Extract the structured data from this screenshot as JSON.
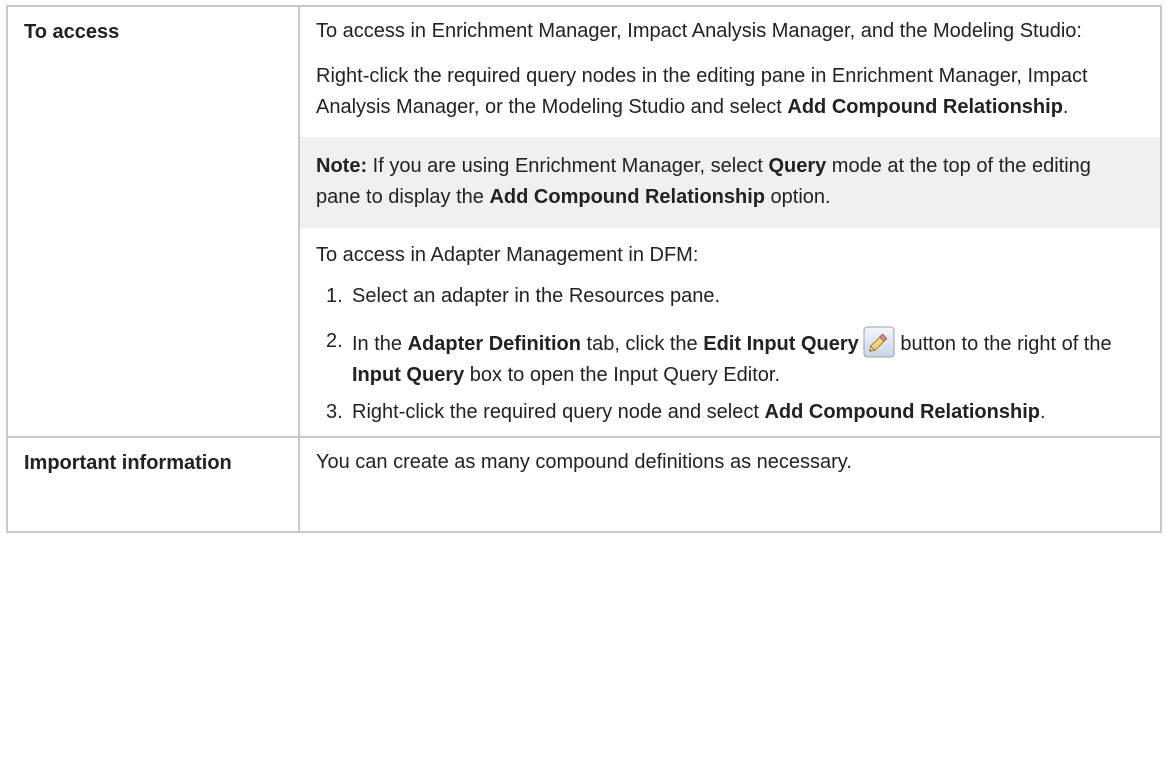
{
  "rows": {
    "access": {
      "label": "To access",
      "intro": "To access in Enrichment Manager, Impact Analysis Manager, and the Modeling Studio:",
      "right_click_pre": "Right-click the required query nodes in the editing pane in Enrichment Manager, Impact Analysis Manager, or the Modeling Studio and select ",
      "right_click_bold": "Add Compound Relationship",
      "right_click_post": ".",
      "note": {
        "label": "Note:",
        "text_1": " If you are using Enrichment Manager, select ",
        "bold_1": "Query",
        "text_2": " mode at the top of the editing pane to display the ",
        "bold_2": "Add Compound Relationship",
        "text_3": " option."
      },
      "adapter_intro": "To access in Adapter Management in DFM:",
      "steps": [
        {
          "num": "1.",
          "text": "Select an adapter in the Resources pane."
        },
        {
          "num": "2.",
          "text_1": "In the ",
          "bold_1": "Adapter Definition",
          "text_2": " tab, click the  ",
          "bold_2": "Edit Input Query",
          "text_3": " button to the right of the ",
          "bold_3": "Input Query",
          "text_4": " box to open the Input Query Editor."
        },
        {
          "num": "3.",
          "text_1": "Right-click the required query node and select ",
          "bold_1": "Add Compound Relationship",
          "text_2": "."
        }
      ]
    },
    "important": {
      "label": "Important information",
      "text": "You can create as many compound definitions as necessary."
    }
  },
  "icons": {
    "edit_input_query": "pencil-edit-icon"
  },
  "colors": {
    "border": "#c8c8c8",
    "note_background": "#f0f0f0",
    "text": "#222222"
  }
}
